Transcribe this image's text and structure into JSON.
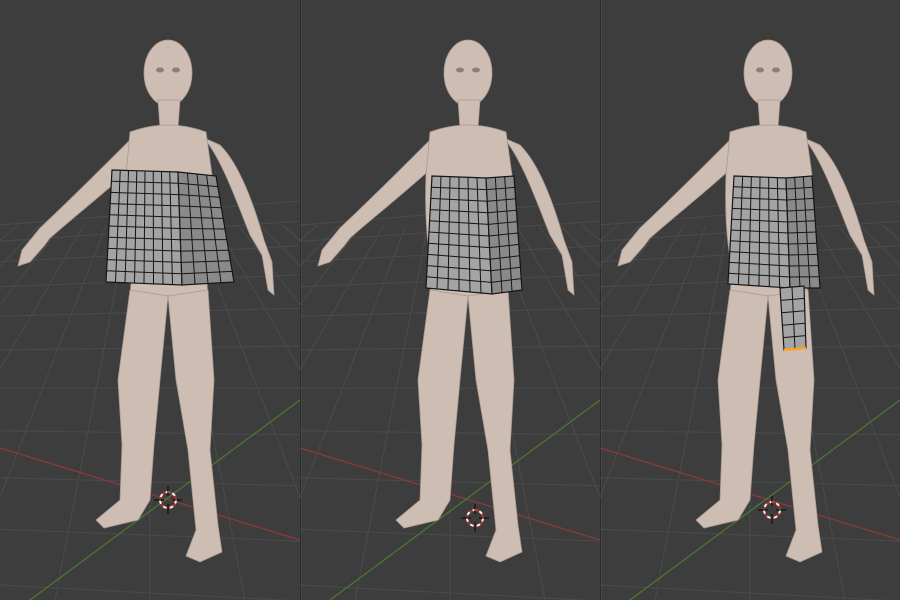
{
  "scene": {
    "editor": "3D Viewport",
    "view_count": 3,
    "views": [
      {
        "name": "view-1",
        "garment_stage": "initial-tube-mesh"
      },
      {
        "name": "view-2",
        "garment_stage": "shrinkwrapped-bodice"
      },
      {
        "name": "view-3",
        "garment_stage": "extruded-skirt-panel-selected-edge"
      }
    ]
  },
  "colors": {
    "background": "#3d3d3d",
    "grid_line": "#4b4b4b",
    "x_axis": "#8e3a3a",
    "y_axis": "#4b7a33",
    "skin": "#cdbdb3",
    "skin_shadow": "#a99a91",
    "mesh_face": "#a4a4a4",
    "mesh_face_dark": "#8a8a8a",
    "wire": "#151515",
    "selected_edge": "#ffa31a",
    "cursor_red": "#e02020",
    "cursor_white": "#f4f4f4"
  },
  "icons": {
    "cursor": "3d-cursor-icon"
  }
}
